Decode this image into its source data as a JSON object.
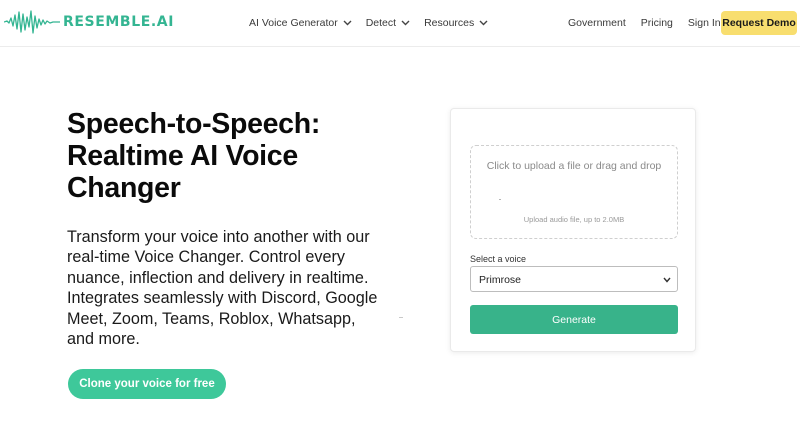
{
  "brand": {
    "name": "RESEMBLE.AI",
    "accent": "#34b592"
  },
  "nav": {
    "items": [
      {
        "label": "AI Voice Generator",
        "icon": "chevron-down-icon"
      },
      {
        "label": "Detect",
        "icon": "chevron-down-icon"
      },
      {
        "label": "Resources",
        "icon": "chevron-down-icon"
      }
    ],
    "right_links": [
      "Government",
      "Pricing",
      "Sign In"
    ],
    "cta_label": "Request Demo",
    "cta_color": "#f8de6f"
  },
  "hero": {
    "title_lines": [
      "Speech-to-Speech:",
      "Realtime AI Voice",
      "Changer"
    ],
    "description_lines": [
      "Transform your voice into another with our",
      "real-time Voice Changer. Control every",
      "nuance, inflection and delivery in realtime.",
      "Integrates seamlessly with Discord, Google",
      "Meet, Zoom, Teams, Roblox, Whatsapp,",
      "and more."
    ],
    "cta_label": "Clone your voice for free",
    "cta_color": "#3ec89a"
  },
  "card": {
    "upload": {
      "prompt": "Click to upload a file or drag and drop",
      "hint": "Upload audio file, up to 2.0MB"
    },
    "voice_select": {
      "label": "Select a voice",
      "selected": "Primrose"
    },
    "generate_label": "Generate",
    "generate_color": "#38b38a"
  }
}
